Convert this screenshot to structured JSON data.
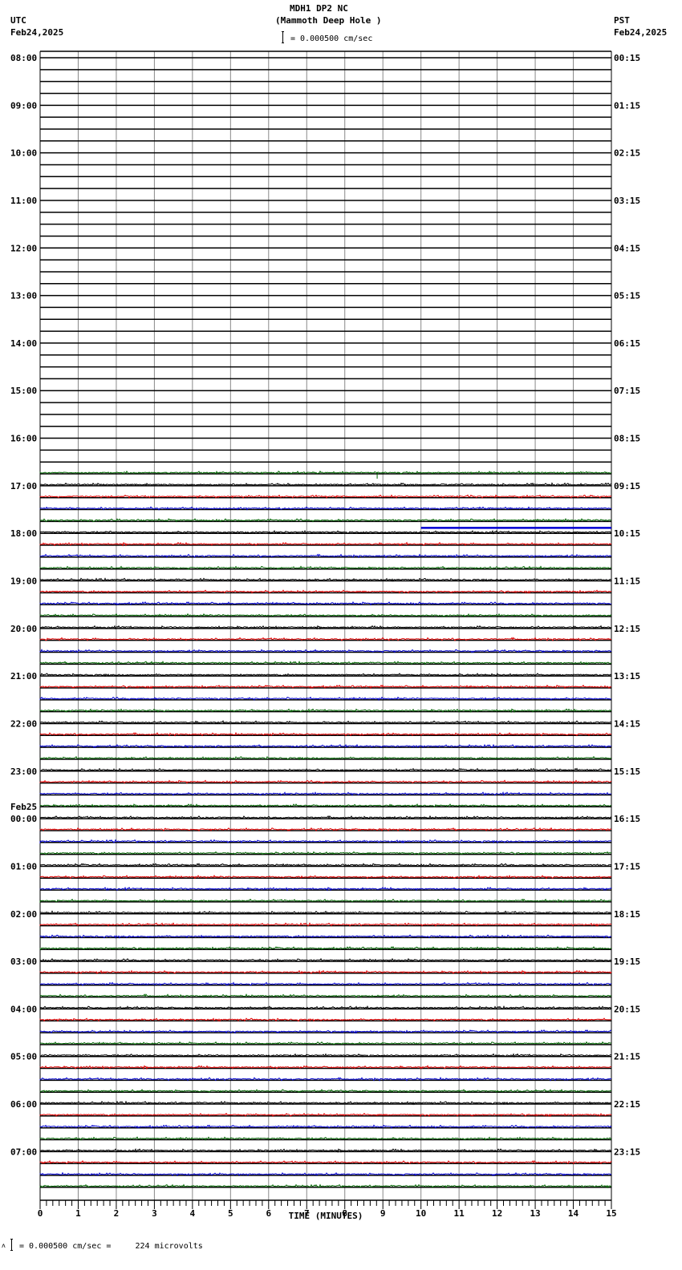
{
  "header": {
    "station": "MDH1 DP2 NC",
    "site": "(Mammoth Deep Hole )",
    "left_tz": "UTC",
    "left_date": "Feb24,2025",
    "right_tz": "PST",
    "right_date": "Feb24,2025",
    "scale": "= 0.000500 cm/sec"
  },
  "footer": {
    "scale": "= 0.000500 cm/sec =     224 microvolts",
    "mark": "ʌ"
  },
  "chart_data": {
    "type": "line",
    "title": "MDH1 DP2 NC (Mammoth Deep Hole )",
    "xlabel": "TIME (MINUTES)",
    "xlim": [
      0,
      15
    ],
    "x_ticks": [
      "0",
      "1",
      "2",
      "3",
      "4",
      "5",
      "6",
      "7",
      "8",
      "9",
      "10",
      "11",
      "12",
      "13",
      "14",
      "15"
    ],
    "rows_per_hour": 4,
    "row_count": 96,
    "first_data_row": 35,
    "trace_colors": [
      "#000000",
      "#e00000",
      "#0000d0",
      "#006400"
    ],
    "left_labels": [
      "08:00",
      "09:00",
      "10:00",
      "11:00",
      "12:00",
      "13:00",
      "14:00",
      "15:00",
      "16:00",
      "17:00",
      "18:00",
      "19:00",
      "20:00",
      "21:00",
      "22:00",
      "23:00",
      "00:00",
      "01:00",
      "02:00",
      "03:00",
      "04:00",
      "05:00",
      "06:00",
      "07:00"
    ],
    "date_change_label": "Feb25",
    "right_labels": [
      "00:15",
      "01:15",
      "02:15",
      "03:15",
      "04:15",
      "05:15",
      "06:15",
      "07:15",
      "08:15",
      "09:15",
      "10:15",
      "11:15",
      "12:15",
      "13:15",
      "14:15",
      "15:15",
      "16:15",
      "17:15",
      "18:15",
      "19:15",
      "20:15",
      "21:15",
      "22:15",
      "23:15"
    ],
    "events": [
      {
        "row": 35,
        "minute": 8.85,
        "note": "small spike"
      },
      {
        "row": 39,
        "minute_start": 10,
        "minute_end": 15,
        "note": "blue offset segment"
      }
    ]
  }
}
